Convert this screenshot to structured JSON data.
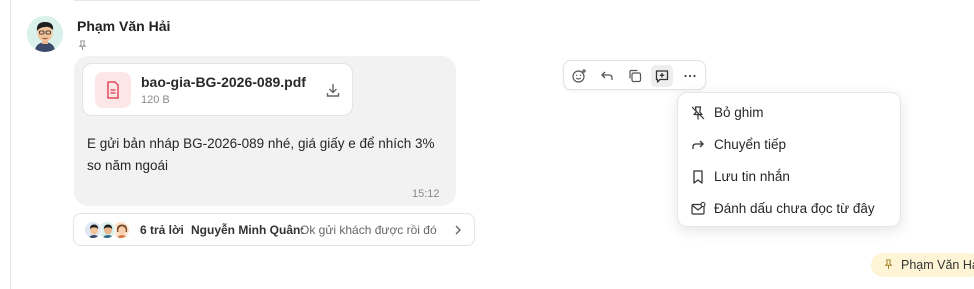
{
  "message": {
    "sender_name": "Phạm Văn Hải",
    "attachment": {
      "file_name": "bao-gia-BG-2026-089.pdf",
      "file_size": "120 B"
    },
    "text": "E gửi bản nháp BG-2026-089 nhé, giá giấy e để nhích 3% so năm ngoái",
    "time": "15:12"
  },
  "thread": {
    "reply_count": "6 trả lời",
    "last_author": "Nguyễn Minh Quân:",
    "last_preview": "Ok gửi khách được rồi đó"
  },
  "toolbar": {
    "buttons": [
      "add-reaction-icon",
      "reply-icon",
      "copy-icon",
      "reply-in-thread-icon",
      "more-icon"
    ],
    "active": "reply-in-thread-icon"
  },
  "context_menu": {
    "items": [
      {
        "label": "Bỏ ghim",
        "icon": "unpin-icon"
      },
      {
        "label": "Chuyển tiếp",
        "icon": "forward-icon"
      },
      {
        "label": "Lưu tin nhắn",
        "icon": "bookmark-icon"
      },
      {
        "label": "Đánh dấu chưa đọc từ đây",
        "icon": "mark-unread-icon"
      }
    ]
  },
  "pinned_chip": {
    "label": "Phạm Văn Hải"
  },
  "colors": {
    "bubble_bg": "#f2f2f2",
    "file_icon_bg": "#fde6e8",
    "file_icon_fg": "#e04b5a",
    "pin_chip_bg": "#fdf5d6",
    "avatar_bg": "#d9f1ea"
  }
}
